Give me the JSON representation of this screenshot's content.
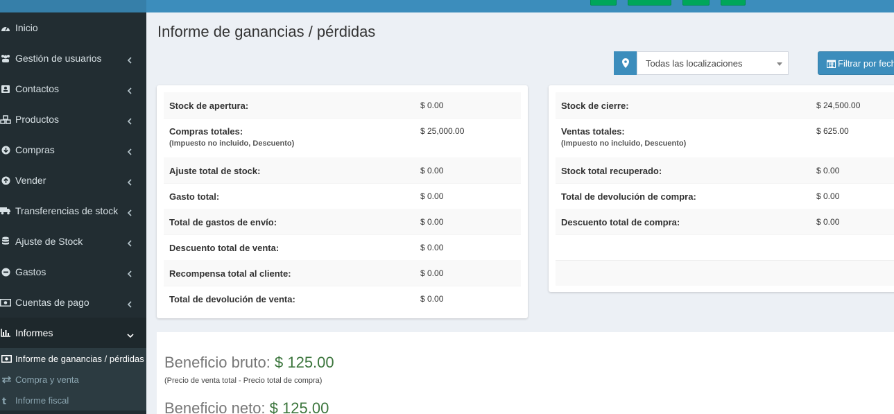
{
  "sidebar": {
    "items": [
      {
        "label": "Inicio",
        "icon": "dashboard-icon",
        "chevron": false
      },
      {
        "label": "Gestión de usuarios",
        "icon": "users-icon",
        "chevron": true
      },
      {
        "label": "Contactos",
        "icon": "address-book-icon",
        "chevron": true
      },
      {
        "label": "Productos",
        "icon": "cubes-icon",
        "chevron": true
      },
      {
        "label": "Compras",
        "icon": "arrow-circle-down-icon",
        "chevron": true
      },
      {
        "label": "Vender",
        "icon": "arrow-circle-up-icon",
        "chevron": true
      },
      {
        "label": "Transferencias de stock",
        "icon": "truck-icon",
        "chevron": true
      },
      {
        "label": "Ajuste de Stock",
        "icon": "database-icon",
        "chevron": true
      },
      {
        "label": "Gastos",
        "icon": "minus-circle-icon",
        "chevron": true
      },
      {
        "label": "Cuentas de pago",
        "icon": "money-icon",
        "chevron": true
      },
      {
        "label": "Informes",
        "icon": "bar-chart-icon",
        "chevron": true
      }
    ],
    "submenu": [
      {
        "label": "Informe de ganancias / pérdidas",
        "icon": "money-icon"
      },
      {
        "label": "Compra y venta",
        "icon": "exchange-icon"
      },
      {
        "label": "Informe fiscal",
        "icon": "tumblr-icon"
      }
    ]
  },
  "page": {
    "title": "Informe de ganancias / pérdidas"
  },
  "filters": {
    "location_icon": "map-marker-icon",
    "location_selected": "Todas las localizaciones",
    "filter_button_label": "Filtrar por fech",
    "filter_icon": "calendar-icon"
  },
  "left_box": {
    "rows": [
      {
        "label": "Stock de apertura:",
        "value": "$ 0.00",
        "note": ""
      },
      {
        "label": "Compras totales:",
        "value": "$ 25,000.00",
        "note": "(Impuesto no incluido, Descuento)"
      },
      {
        "label": "Ajuste total de stock:",
        "value": "$ 0.00",
        "note": ""
      },
      {
        "label": "Gasto total:",
        "value": "$ 0.00",
        "note": ""
      },
      {
        "label": "Total de gastos de envío:",
        "value": "$ 0.00",
        "note": ""
      },
      {
        "label": "Descuento total de venta:",
        "value": "$ 0.00",
        "note": ""
      },
      {
        "label": "Recompensa total al cliente:",
        "value": "$ 0.00",
        "note": ""
      },
      {
        "label": "Total de devolución de venta:",
        "value": "$ 0.00",
        "note": ""
      }
    ]
  },
  "right_box": {
    "rows": [
      {
        "label": "Stock de cierre:",
        "value": "$ 24,500.00",
        "note": ""
      },
      {
        "label": "Ventas totales:",
        "value": "$ 625.00",
        "note": "(Impuesto no incluido, Descuento)"
      },
      {
        "label": "Stock total recuperado:",
        "value": "$ 0.00",
        "note": ""
      },
      {
        "label": "Total de devolución de compra:",
        "value": "$ 0.00",
        "note": ""
      },
      {
        "label": "Descuento total de compra:",
        "value": "$ 0.00",
        "note": ""
      }
    ]
  },
  "profit": {
    "gross_label": "Beneficio bruto:",
    "gross_amount": "$ 125.00",
    "gross_note": "(Precio de venta total - Precio total de compra)",
    "net_label": "Beneficio neto:",
    "net_amount": "$ 125.00"
  },
  "colors": {
    "sidebar_bg": "#222d32",
    "topbar_bg": "#3c8dbc",
    "primary": "#3c8dbc",
    "success": "#00a65a",
    "profit_amount": "#3c763d"
  }
}
